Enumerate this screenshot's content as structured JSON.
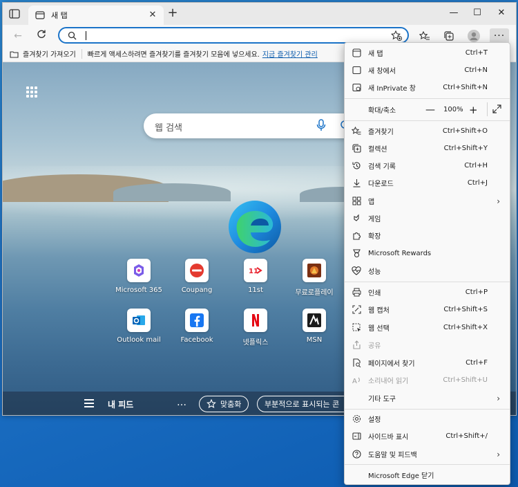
{
  "browser": {
    "tab_title": "새 탭",
    "address_value": "",
    "favbar": {
      "import_label": "즐겨찾기 가져오기",
      "hint_text": "빠르게 액세스하려면 즐겨찾기를 즐겨찾기 모음에 넣으세요.",
      "manage_link": "지금 즐겨찾기 관리"
    }
  },
  "ntp": {
    "search_placeholder": "웹 검색",
    "tiles": [
      {
        "label": "Microsoft 365"
      },
      {
        "label": "Coupang"
      },
      {
        "label": "11st"
      },
      {
        "label": "무료로플레이"
      },
      {
        "label": "Outlook mail"
      },
      {
        "label": "Facebook"
      },
      {
        "label": "넷플릭스"
      },
      {
        "label": "MSN"
      }
    ],
    "feed_title": "내 피드",
    "feed_dots": "…",
    "personalize_label": "맞춤화",
    "partial_label": "부분적으로 표시되는 콘"
  },
  "menu": {
    "new_tab": {
      "label": "새 탭",
      "shortcut": "Ctrl+T"
    },
    "new_window": {
      "label": "새 창에서",
      "shortcut": "Ctrl+N"
    },
    "new_inprivate": {
      "label": "새 InPrivate 창",
      "shortcut": "Ctrl+Shift+N"
    },
    "zoom": {
      "label": "확대/축소",
      "minus": "—",
      "value": "100%",
      "plus": "+"
    },
    "favorites": {
      "label": "즐겨찾기",
      "shortcut": "Ctrl+Shift+O"
    },
    "collections": {
      "label": "컬렉션",
      "shortcut": "Ctrl+Shift+Y"
    },
    "history": {
      "label": "검색 기록",
      "shortcut": "Ctrl+H"
    },
    "downloads": {
      "label": "다운로드",
      "shortcut": "Ctrl+J"
    },
    "apps": {
      "label": "앱"
    },
    "games": {
      "label": "게임"
    },
    "extensions": {
      "label": "확장"
    },
    "rewards": {
      "label": "Microsoft Rewards"
    },
    "performance": {
      "label": "성능"
    },
    "print": {
      "label": "인쇄",
      "shortcut": "Ctrl+P"
    },
    "web_capture": {
      "label": "웹 캡처",
      "shortcut": "Ctrl+Shift+S"
    },
    "web_select": {
      "label": "웹 선택",
      "shortcut": "Ctrl+Shift+X"
    },
    "share": {
      "label": "공유"
    },
    "find": {
      "label": "페이지에서 찾기",
      "shortcut": "Ctrl+F"
    },
    "read_aloud": {
      "label": "소리내어 읽기",
      "shortcut": "Ctrl+Shift+U"
    },
    "more_tools": {
      "label": "기타 도구"
    },
    "settings": {
      "label": "설정"
    },
    "sidebar": {
      "label": "사이드바 표시",
      "shortcut": "Ctrl+Shift+/"
    },
    "help": {
      "label": "도움말 및 피드백"
    },
    "close_edge": {
      "label": "Microsoft Edge 닫기"
    }
  },
  "colors": {
    "accent": "#1a73c8",
    "menu_bg": "#f9f9f9"
  }
}
